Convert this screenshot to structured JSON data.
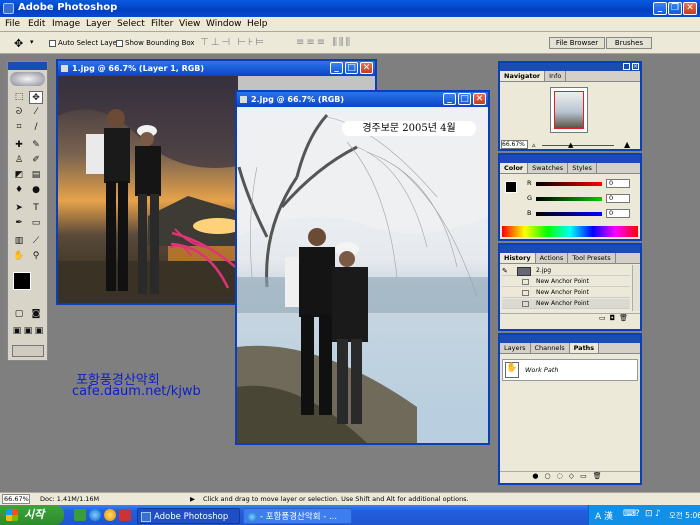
{
  "app": {
    "title": "Adobe Photoshop"
  },
  "menu": [
    "File",
    "Edit",
    "Image",
    "Layer",
    "Select",
    "Filter",
    "View",
    "Window",
    "Help"
  ],
  "options": {
    "auto_select": "Auto Select Layer",
    "show_bounding": "Show Bounding Box",
    "file_browser": "File Browser",
    "brushes": "Brushes"
  },
  "doc1": {
    "title": "1.jpg @ 66.7% (Layer 1, RGB)"
  },
  "doc2": {
    "title": "2.jpg @ 66.7% (RGB)",
    "caption": "경주보문 2005년 4월"
  },
  "watermark": {
    "line1": "포항풍경산악회",
    "line2": "cafe.daum.net/kjwb"
  },
  "navigator": {
    "tabs": [
      "Navigator",
      "Info"
    ],
    "zoom": "66.67%"
  },
  "color": {
    "tabs": [
      "Color",
      "Swatches",
      "Styles"
    ],
    "channels": [
      {
        "label": "R",
        "value": "0"
      },
      {
        "label": "G",
        "value": "0"
      },
      {
        "label": "B",
        "value": "0"
      }
    ]
  },
  "history": {
    "tabs": [
      "History",
      "Actions",
      "Tool Presets"
    ],
    "items": [
      "2.jpg",
      "New Anchor Point",
      "New Anchor Point",
      "New Anchor Point"
    ]
  },
  "layers": {
    "tabs": [
      "Layers",
      "Channels",
      "Paths"
    ],
    "path_item": "Work Path"
  },
  "status": {
    "zoom": "66.67%",
    "doc": "Doc: 1.41M/1.16M",
    "hint": "Click and drag to move layer or selection. Use Shift and Alt for additional options."
  },
  "taskbar": {
    "start": "시작",
    "tasks": [
      "Adobe Photoshop",
      "- 포항풍경산악회 - ..."
    ],
    "tray_lang": "A 漢",
    "time": "오전 5:06"
  }
}
